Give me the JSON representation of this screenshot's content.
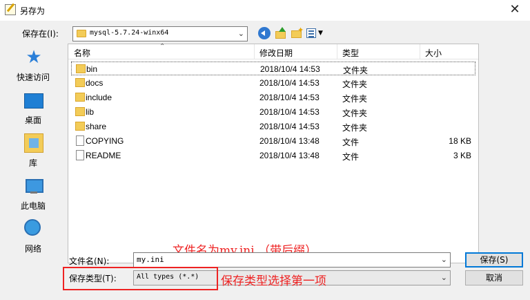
{
  "window": {
    "title": "另存为",
    "close_glyph": "✕"
  },
  "save_in": {
    "label": "保存在(I):",
    "value": "mysql-5.7.24-winx64",
    "arrow": "⌄"
  },
  "places": [
    {
      "label": "快速访问",
      "icon": "quick-access-star-icon"
    },
    {
      "label": "桌面",
      "icon": "desktop-icon"
    },
    {
      "label": "库",
      "icon": "libraries-icon"
    },
    {
      "label": "此电脑",
      "icon": "this-pc-icon"
    },
    {
      "label": "网络",
      "icon": "network-icon"
    }
  ],
  "columns": {
    "name": "名称",
    "date": "修改日期",
    "type": "类型",
    "size": "大小",
    "sort_glyph": "⌃"
  },
  "files": [
    {
      "name": "bin",
      "date": "2018/10/4 14:53",
      "type": "文件夹",
      "size": "",
      "kind": "folder"
    },
    {
      "name": "docs",
      "date": "2018/10/4 14:53",
      "type": "文件夹",
      "size": "",
      "kind": "folder"
    },
    {
      "name": "include",
      "date": "2018/10/4 14:53",
      "type": "文件夹",
      "size": "",
      "kind": "folder"
    },
    {
      "name": "lib",
      "date": "2018/10/4 14:53",
      "type": "文件夹",
      "size": "",
      "kind": "folder"
    },
    {
      "name": "share",
      "date": "2018/10/4 14:53",
      "type": "文件夹",
      "size": "",
      "kind": "folder"
    },
    {
      "name": "COPYING",
      "date": "2018/10/4 13:48",
      "type": "文件",
      "size": "18 KB",
      "kind": "file"
    },
    {
      "name": "README",
      "date": "2018/10/4 13:48",
      "type": "文件",
      "size": "3 KB",
      "kind": "file"
    }
  ],
  "filename": {
    "label": "文件名(N):",
    "value": "my.ini",
    "arrow": "⌄"
  },
  "filetype": {
    "label": "保存类型(T):",
    "value": "All types (*.*)",
    "arrow": "⌄"
  },
  "buttons": {
    "save": "保存(S)",
    "cancel": "取消"
  },
  "annotations": {
    "filename_note": "文件名为my.ini （带后缀）",
    "type_note": "保存类型选择第一项"
  },
  "colors": {
    "annotation": "#e22222",
    "accent": "#0078d7"
  }
}
